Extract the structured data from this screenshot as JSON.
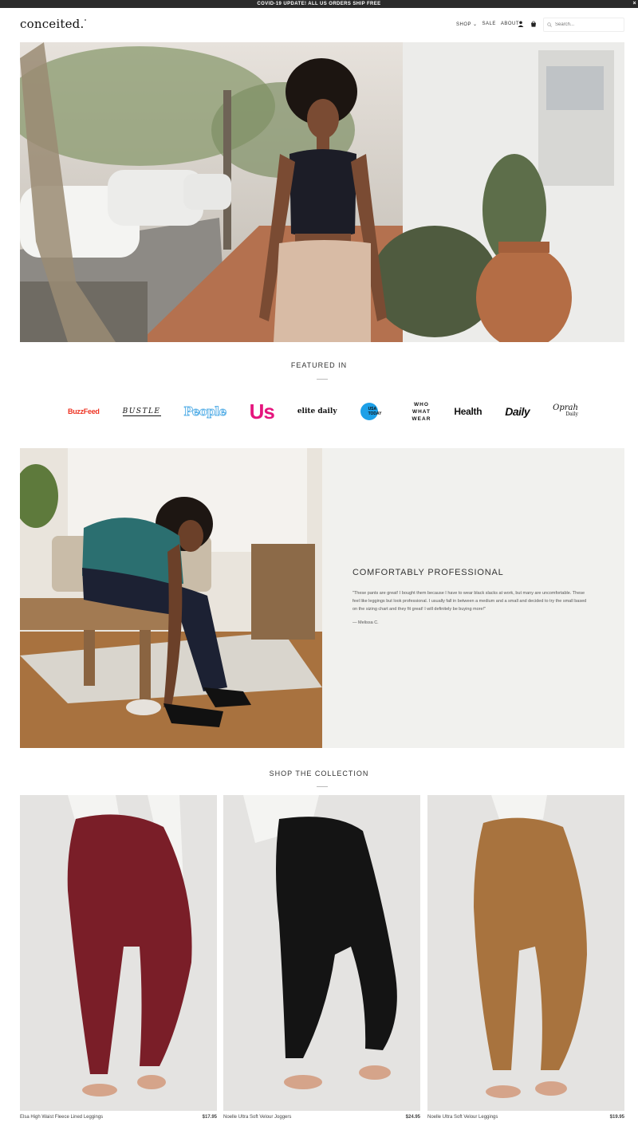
{
  "announcement": {
    "text": "COVID-19 UPDATE! ALL US ORDERS SHIP FREE",
    "close": "×"
  },
  "header": {
    "logo": "conceited.",
    "nav": {
      "shop": "SHOP",
      "sale": "SALE",
      "about": "ABOUT"
    },
    "icons": [
      "account-icon",
      "cart-icon",
      "search-icon"
    ],
    "search_placeholder": "Search..."
  },
  "featured": {
    "title": "FEATURED IN",
    "logos": {
      "buzzfeed": "BuzzFeed",
      "bustle": "BUSTLE",
      "people": "People",
      "us": "Us",
      "elite": "elite daily",
      "usatoday": "USA TODAY",
      "www1": "WHO",
      "www2": "WHAT",
      "www3": "WEAR",
      "health": "Health",
      "daily": "Daily",
      "oprah1": "Oprah",
      "oprah2": "Daily"
    }
  },
  "testimonial": {
    "heading": "COMFORTABLY PROFESSIONAL",
    "quote": "\"These pants are great! I bought them because I have to wear black slacks at work, but many are uncomfortable. These feel like leggings but look professional. I usually fall in between a medium and a small and decided to try the small based on the sizing chart and they fit great! I will definitely be buying more!\"",
    "author": "— Melissa C."
  },
  "collection": {
    "title": "SHOP THE COLLECTION",
    "products": [
      {
        "name": "Elsa High Waist Fleece Lined Leggings",
        "price": "$17.95"
      },
      {
        "name": "Noelle Ultra Soft Velour Joggers",
        "price": "$24.95"
      },
      {
        "name": "Noelle Ultra Soft Velour Leggings",
        "price": "$19.95"
      }
    ]
  },
  "colors": {
    "announcement_bg": "#2b2b2b",
    "buzzfeed_red": "#ee3322",
    "people_blue": "#5fb3e8",
    "us_pink": "#e5157d",
    "usatoday_blue": "#1da0e8",
    "testimonial_bg": "#f1f1ee",
    "legging_burgundy": "#7a1e28",
    "jogger_black": "#141414",
    "legging_camel": "#a8733e"
  }
}
